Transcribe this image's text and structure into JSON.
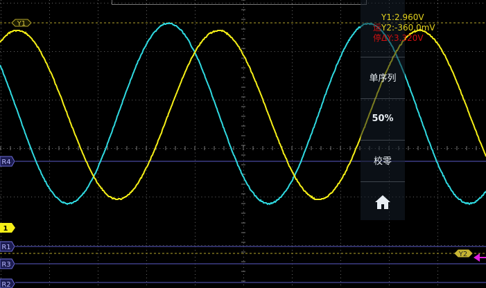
{
  "readouts": {
    "y1": "Y1:2.960V",
    "y2": "Y2:-360.0mV",
    "dy": "ΔY:3.320V",
    "y1_color": "#e3d21e",
    "y2_color": "#e3d21e",
    "dy_color": "#d01010"
  },
  "overlay_text": [
    "运",
    "停"
  ],
  "menu": {
    "single_sequence": "单序列",
    "trigger_50": "50%",
    "zero_cal": "校零",
    "home_icon": "home-icon"
  },
  "cursors": {
    "y1_label": "Y1",
    "y2_label": "Y2"
  },
  "channels": {
    "ch1_label": "1",
    "r4_label": "R4",
    "r1_label": "R1",
    "r3_label": "R3",
    "r2_label": "R2"
  },
  "colors": {
    "ch1": "#f5ef17",
    "ch2": "#2fd9e0",
    "ref": "#6c6cd8",
    "cursor": "#b8a82c",
    "trigger": "#e020e0",
    "grid": "#5a5a5a"
  }
}
